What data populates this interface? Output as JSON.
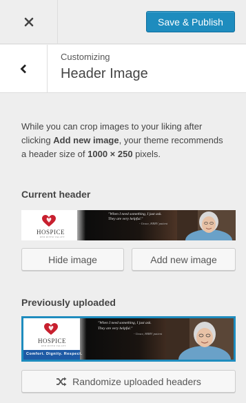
{
  "topbar": {
    "close_icon": "close-icon",
    "publish_label": "Save & Publish"
  },
  "section": {
    "back_icon": "chevron-left-icon",
    "breadcrumb": "Customizing",
    "title": "Header Image"
  },
  "description": {
    "part1": "While you can crop images to your liking after clicking ",
    "bold1": "Add new image",
    "part2": ", your theme recommends a header size of ",
    "bold2": "1000 × 250",
    "part3": " pixels."
  },
  "current_header": {
    "label": "Current header",
    "logo_text": "HOSPICE",
    "logo_sub": "RED RIVER VALLEY",
    "quote_line1": "\"When I need something, I just ask.",
    "quote_line2": "They are very helpful.\"",
    "quote_attr": "- Grace, HRRV patient"
  },
  "buttons": {
    "hide_label": "Hide image",
    "add_label": "Add new image"
  },
  "previous": {
    "label": "Previously uploaded",
    "logo_text": "HOSPICE",
    "logo_sub": "RED RIVER VALLEY",
    "tagline": "Comfort. Dignity. Respect.",
    "quote_line1": "\"When I need something, I just ask.",
    "quote_line2": "They are very helpful.\"",
    "quote_attr": "- Grace, HRRV patient"
  },
  "randomize": {
    "icon": "shuffle-icon",
    "label": "Randomize uploaded headers"
  },
  "colors": {
    "accent": "#1e8cbe",
    "background": "#eeeeee",
    "brand_red": "#c8202f"
  }
}
